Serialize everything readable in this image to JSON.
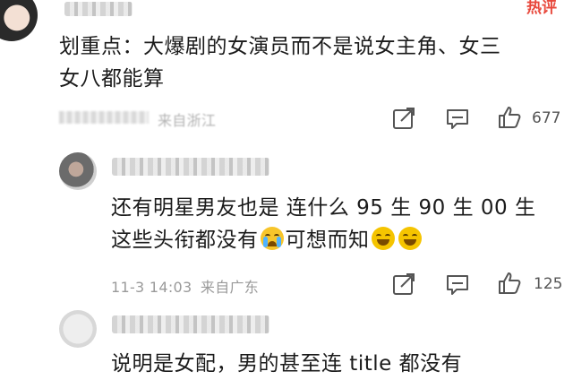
{
  "badge": {
    "label": "热评",
    "color": "#e8483c"
  },
  "comment1": {
    "body": "划重点：大爆剧的女演员而不是说女主角、女三女八都能算",
    "line1": "划重点：大爆剧的女演员而不是说女主角、女三",
    "line2": "女八都能算",
    "meta_visible": "来自浙江",
    "likes": "677"
  },
  "reply1": {
    "line1": "还有明星男友也是 连什么 95 生 90 生 00 生",
    "line2_a": "这些头衔都没有",
    "line2_b": "可想而知",
    "date": "11-3 14:03",
    "location": "来自广东",
    "likes": "125"
  },
  "reply2": {
    "partial": "说明是女配，男的甚至连 title 都没有"
  },
  "icons": {
    "share": "share-icon",
    "comment": "comment-icon",
    "like": "thumbs-up-icon",
    "emoji_cry": "crying-face-emoji",
    "emoji_laugh": "tears-of-joy-emoji"
  }
}
